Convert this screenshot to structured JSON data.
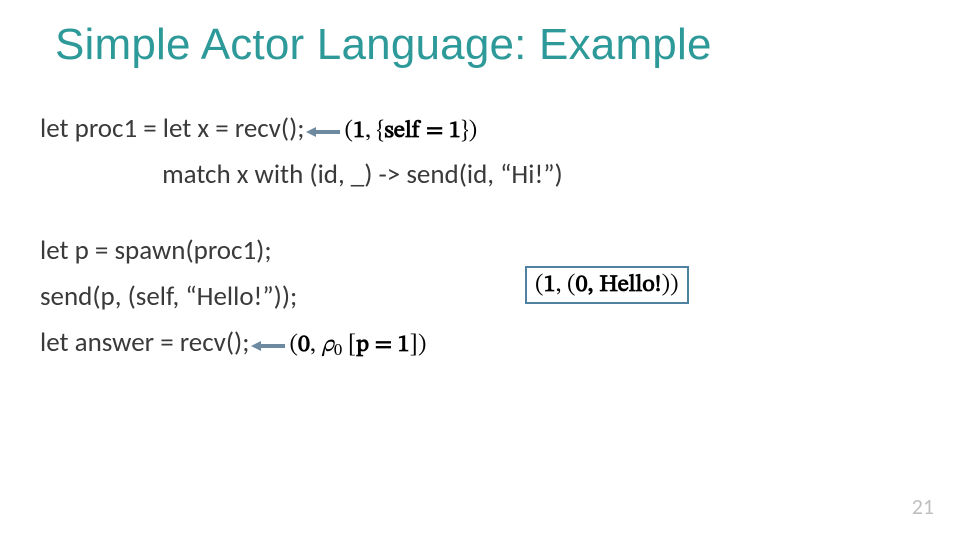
{
  "title": "Simple Actor Language: Example",
  "code": {
    "line1": "let proc1 = let x = recv();",
    "line2": "                    match x with (id, _) -> send(id, “Hi!”)",
    "line3": "let p = spawn(proc1);",
    "line4": "send(p, (self, “Hello!”));",
    "line5": "let answer = recv();"
  },
  "annotations": {
    "a1_prefix": "(",
    "a1_one": "1",
    "a1_mid": ", {",
    "a1_self": "self = 1",
    "a1_suffix": "})",
    "box_prefix": "(",
    "box_one": "1",
    "box_mid": ", (",
    "box_zero": "0",
    "box_hello": ", Hello!",
    "box_suffix": "))",
    "a2_prefix": "(",
    "a2_zero": "0",
    "a2_comma": ", ",
    "a2_rho": "ρ",
    "a2_sub": "0",
    "a2_space": " ",
    "a2_bracket_open": "[",
    "a2_p": "p = 1",
    "a2_bracket_close": "])"
  },
  "page_number": "21",
  "icons": {
    "arrow": "left-arrow-icon"
  }
}
